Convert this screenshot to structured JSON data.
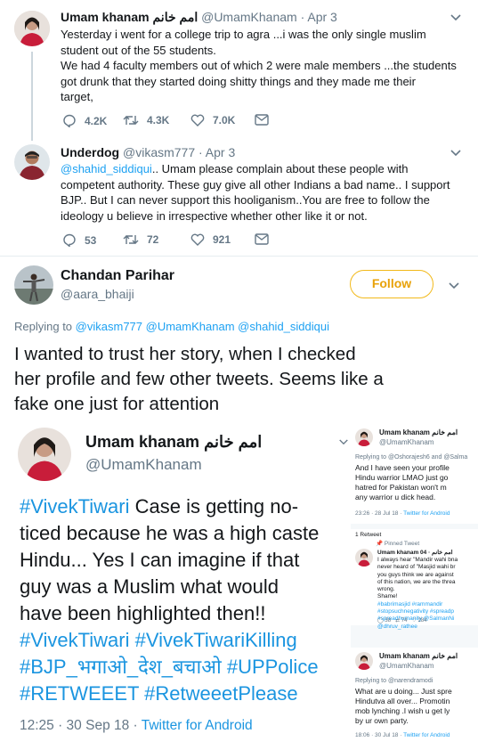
{
  "tweet1": {
    "name": "Umam khanam امم خانم",
    "handle": "@UmamKhanam",
    "date": "· Apr 3",
    "lines": [
      "Yesterday i went for a college trip to agra ...i was the only single muslim",
      "student out of the 55 students.",
      "We had 4 faculty members out of which 2 were male members ...the students",
      "got drunk that they started doing shitty things and they made me their",
      "target,"
    ],
    "replies": "4.2K",
    "retweets": "4.3K",
    "likes": "7.0K"
  },
  "tweet2": {
    "name": "Underdog",
    "handle": "@vikasm777",
    "date": "· Apr 3",
    "mention": "@shahid_siddiqui",
    "line1_rest": ".. Umam please complain about these people with",
    "lines": [
      "competent authority. These guy give all other Indians a bad name.. I support",
      "BJP.. But I can never support this hooliganism..You are free to follow the",
      "ideology u believe in irrespective whether other like it or not."
    ],
    "replies": "53",
    "retweets": "72",
    "likes": "921"
  },
  "tweet3": {
    "name": "Chandan Parihar",
    "handle": "@aara_bhaiji",
    "follow_label": "Follow",
    "replying_prefix": "Replying to",
    "replying_to": [
      "@vikasm777",
      "@UmamKhanam",
      "@shahid_siddiqui"
    ],
    "lines": [
      "I wanted to trust her story, when I checked",
      "her profile and few other tweets. Seems like a",
      "fake one just for attention"
    ]
  },
  "embed": {
    "name": "Umam khanam امم خانم",
    "handle": "@UmamKhanam",
    "text_parts": [
      {
        "t": "#VivekTiwari",
        "tag": true
      },
      {
        "t": " Case is getting no-\nticed because he was a high caste\nHindu... Yes I can imagine if that\nguy was a Muslim what would\nhave been highlighted then!!\n",
        "tag": false
      },
      {
        "t": "#VivekTiwari #VivekTiwariKilling\n#BJP_भगाओ_देश_बचाओ #UPPolice\n#RETWEEET #RetweeetPlease",
        "tag": true
      }
    ],
    "time": "12:25 · 30 Sep 18 · ",
    "source": "Twitter for Android",
    "side1": {
      "name": "Umam khanam امم خانم",
      "handle": "@UmamKhanam",
      "replying": "Replying to @Oshorajesh6 and @Salma",
      "lines": [
        "And I have seen your profile",
        "Hindu warrior LMAO just go",
        "hatred for Pakistan won't m",
        "any warrior u dick head."
      ],
      "stamp": "23:26 · 28 Jul 18 · ",
      "source": "Twitter for Android"
    },
    "side2": {
      "retweet_count": "1 Retweet",
      "pinned": "Pinned Tweet",
      "name": "Umam khanam امم خانم · 04",
      "lines": [
        "I always hear \"Mandir wahi bna",
        "never heard of \"Masjid wahi br",
        "you guys think we are against",
        "of this nation, we are the threa",
        "wrong.",
        "Shame!"
      ],
      "tags": [
        "#babrimasjid #rammandir",
        "#stopsuchnegativity #spreadp",
        "#spreadhumanity @SalmanNi",
        "@dhruv_rathee"
      ],
      "replies": "38",
      "retweets": "74",
      "likes": "284"
    },
    "side3": {
      "name": "Umam khanam امم خانم",
      "handle": "@UmamKhanam",
      "replying": "Replying to @narendramodi",
      "lines": [
        "What are u doing... Just spre",
        "Hindutva all over... Promotin",
        "mob lynching .I wish u get ly",
        "by ur own party."
      ],
      "stamp": "18:06 · 30 Jul 18 · ",
      "source": "Twitter for Android"
    }
  }
}
